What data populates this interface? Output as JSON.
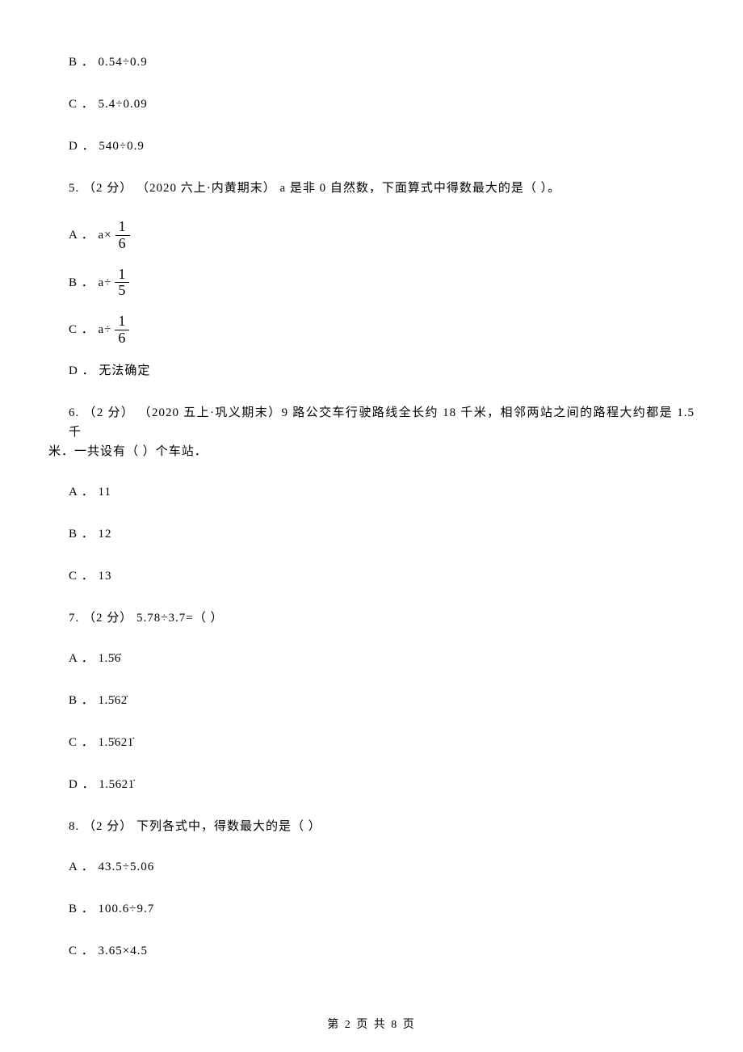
{
  "options_top": {
    "b": "B ． 0.54÷0.9",
    "c": "C ． 5.4÷0.09",
    "d": "D ． 540÷0.9"
  },
  "q5": {
    "stem": "5. （2 分） （2020 六上·内黄期末） a 是非 0 自然数，下面算式中得数最大的是（    ）。",
    "a_prefix": "A ． a×",
    "a_frac_num": "1",
    "a_frac_den": "6",
    "b_prefix": "B ． a÷",
    "b_frac_num": "1",
    "b_frac_den": "5",
    "c_prefix": "C ． a÷",
    "c_frac_num": "1",
    "c_frac_den": "6",
    "d": "D ． 无法确定"
  },
  "q6": {
    "stem_line1": "6. （2 分） （2020 五上·巩义期末）9 路公交车行驶路线全长约 18 千米，相邻两站之间的路程大约都是 1.5 千",
    "stem_line2": "米．一共设有（    ）个车站．",
    "a": "A ． 11",
    "b": "B ． 12",
    "c": "C ． 13"
  },
  "q7": {
    "stem": "7. （2 分） 5.78÷3.7=（    ）",
    "a_prefix": "A ． ",
    "a_val": "1.5̇6̇",
    "b_prefix": "B ． ",
    "b_val": "1.5̇62̇",
    "c_prefix": "C ． ",
    "c_val": "1.5̇621̇",
    "d_prefix": "D ． ",
    "d_val": "1.5621̇"
  },
  "q8": {
    "stem": "8. （2 分） 下列各式中，得数最大的是（    ）",
    "a": "A ． 43.5÷5.06",
    "b": "B ． 100.6÷9.7",
    "c": "C ． 3.65×4.5"
  },
  "footer": "第 2 页 共 8 页"
}
